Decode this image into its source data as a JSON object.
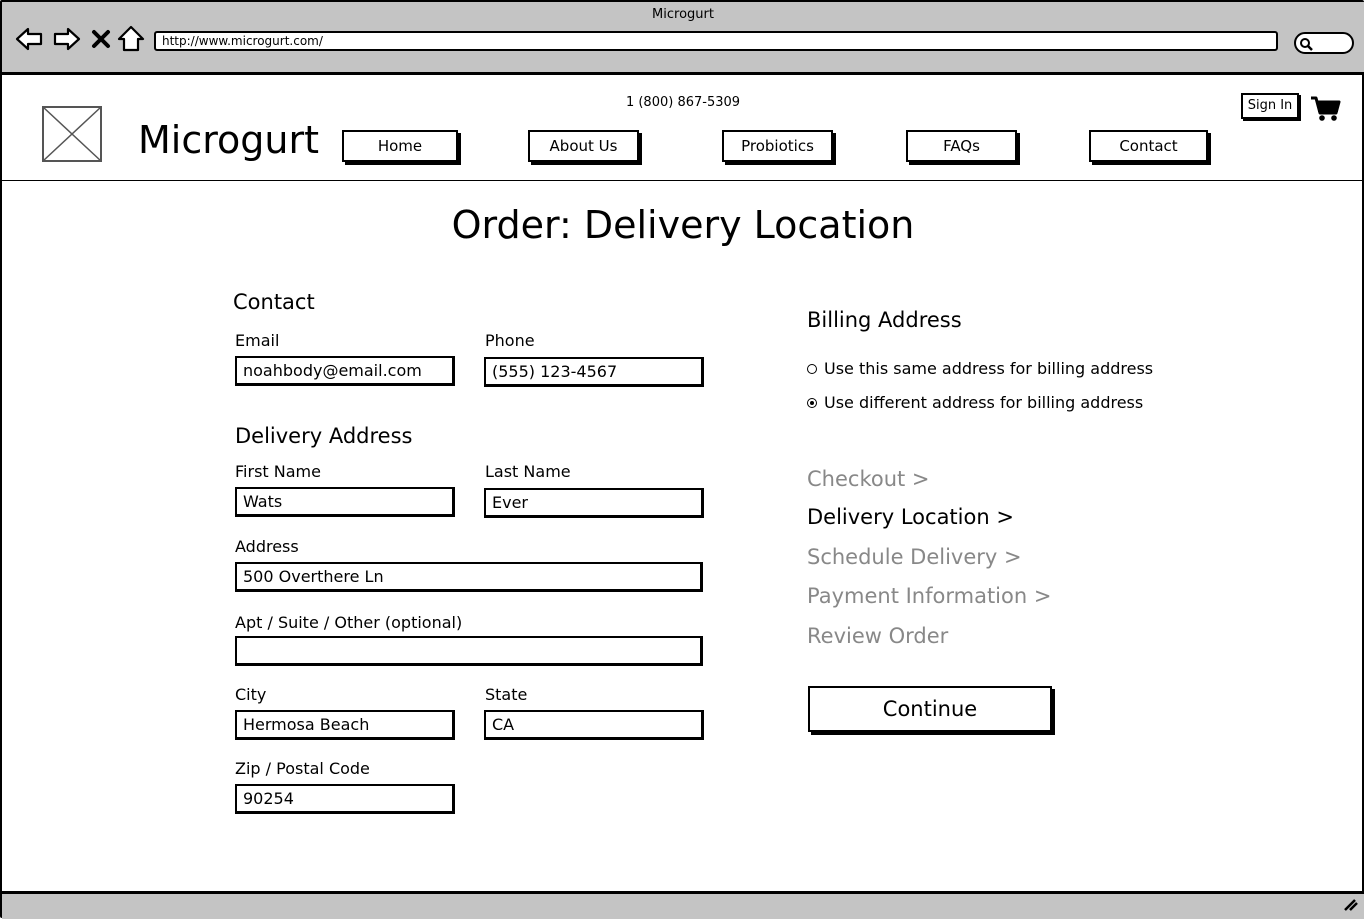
{
  "browser": {
    "window_title": "Microgurt",
    "url": "http://www.microgurt.com/"
  },
  "header": {
    "phone": "1 (800) 867-5309",
    "brand": "Microgurt",
    "sign_in": "Sign In",
    "nav": [
      {
        "label": "Home"
      },
      {
        "label": "About Us"
      },
      {
        "label": "Probiotics"
      },
      {
        "label": "FAQs"
      },
      {
        "label": "Contact"
      }
    ]
  },
  "page": {
    "title": "Order: Delivery Location"
  },
  "contact": {
    "heading": "Contact",
    "email_label": "Email",
    "email_value": "noahbody@email.com",
    "phone_label": "Phone",
    "phone_value": "(555) 123-4567"
  },
  "delivery": {
    "heading": "Delivery Address",
    "first_name_label": "First Name",
    "first_name_value": "Wats",
    "last_name_label": "Last Name",
    "last_name_value": "Ever",
    "address_label": "Address",
    "address_value": "500 Overthere Ln",
    "apt_label": "Apt / Suite / Other (optional)",
    "apt_value": "",
    "city_label": "City",
    "city_value": "Hermosa Beach",
    "state_label": "State",
    "state_value": "CA",
    "zip_label": "Zip / Postal Code",
    "zip_value": "90254"
  },
  "billing": {
    "heading": "Billing Address",
    "options": [
      {
        "label": "Use this same address for billing address",
        "selected": false
      },
      {
        "label": "Use different address for billing address",
        "selected": true
      }
    ]
  },
  "steps": [
    {
      "label": "Checkout >",
      "active": false
    },
    {
      "label": "Delivery Location >",
      "active": true
    },
    {
      "label": "Schedule Delivery >",
      "active": false
    },
    {
      "label": "Payment Information >",
      "active": false
    },
    {
      "label": "Review Order",
      "active": false
    }
  ],
  "continue_label": "Continue",
  "colors": {
    "chrome": "#c4c4c4",
    "inactive_step": "#888888"
  }
}
